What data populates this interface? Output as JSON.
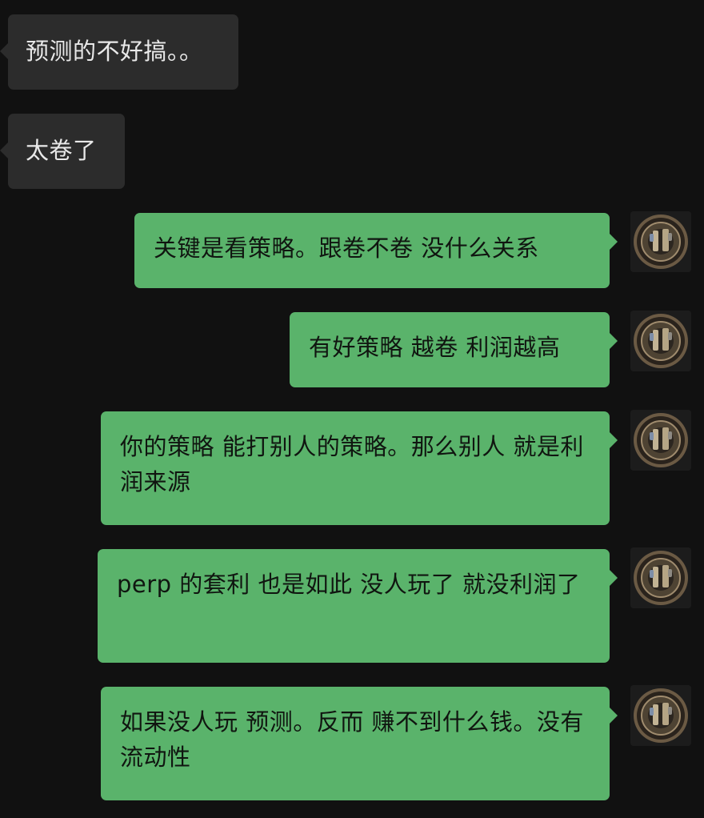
{
  "messages": [
    {
      "side": "in",
      "text": "预测的不好搞。。"
    },
    {
      "side": "in",
      "text": "太卷了"
    },
    {
      "side": "out",
      "text": "关键是看策略。跟卷不卷 没什么关系"
    },
    {
      "side": "out",
      "text": "有好策略 越卷 利润越高"
    },
    {
      "side": "out",
      "text": "你的策略 能打别人的策略。那么别人 就是利润来源"
    },
    {
      "side": "out",
      "text": "perp 的套利  也是如此 没人玩了  就没利润了"
    },
    {
      "side": "out",
      "text": "如果没人玩 预测。反而 赚不到什么钱。没有流动性"
    }
  ],
  "colors": {
    "background": "#111111",
    "incoming_bubble": "#2c2c2c",
    "outgoing_bubble": "#5ab36b"
  },
  "avatar_icon": "ornate-coin-avatar-icon"
}
